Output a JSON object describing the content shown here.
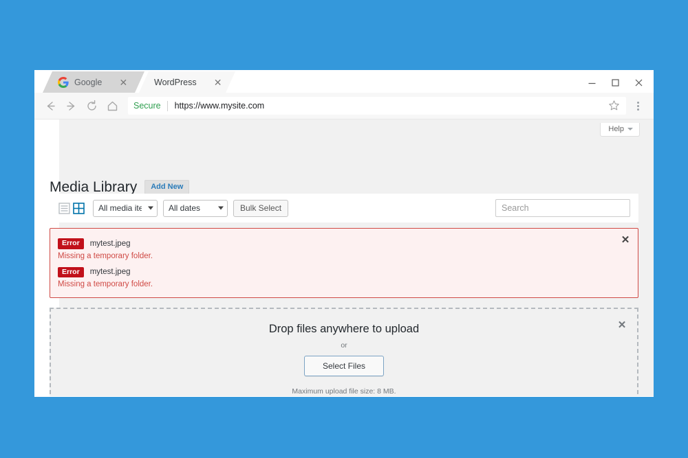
{
  "browser": {
    "tabs": [
      {
        "title": "Google",
        "favicon": "google-icon",
        "active": false,
        "close_label": "✕"
      },
      {
        "title": "WordPress",
        "favicon": "none",
        "active": true,
        "close_label": "✕"
      }
    ],
    "new_tab_label": "",
    "window_controls": {
      "minimize": "—",
      "maximize": "□",
      "close": "✕"
    },
    "nav": {
      "back": "back-arrow-icon",
      "forward": "forward-arrow-icon",
      "reload": "reload-icon",
      "home": "home-icon"
    },
    "omnibox": {
      "security_label": "Secure",
      "url": "https://www.mysite.com",
      "bookmark": "star-icon"
    },
    "menu": "chrome-menu-icon"
  },
  "page": {
    "help_tab": {
      "label": "Help"
    },
    "title": "Media Library",
    "add_new_label": "Add New",
    "toolbar": {
      "view_list_label": "list-view",
      "view_grid_label": "grid-view",
      "media_items_select": "All media items",
      "dates_select": "All dates",
      "bulk_select_label": "Bulk Select",
      "search_placeholder": "Search",
      "search_value": ""
    },
    "errors": {
      "dismiss_label": "✕",
      "items": [
        {
          "badge": "Error",
          "filename": "mytest.jpeg",
          "message": "Missing a temporary folder."
        },
        {
          "badge": "Error",
          "filename": "mytest.jpeg",
          "message": "Missing a temporary folder."
        }
      ]
    },
    "drop_zone": {
      "dismiss_label": "✕",
      "headline": "Drop files anywhere to upload",
      "or_label": "or",
      "select_files_label": "Select Files",
      "max_size_note": "Maximum upload file size: 8 MB."
    }
  },
  "colors": {
    "desktop_background": "#3498db",
    "error_border": "#cf4944",
    "error_background": "#fdf1f1",
    "error_badge": "#c1101a",
    "wp_accent_blue": "#2a7bb9",
    "secure_green": "#2e9e4e",
    "page_background": "#f1f1f1"
  }
}
